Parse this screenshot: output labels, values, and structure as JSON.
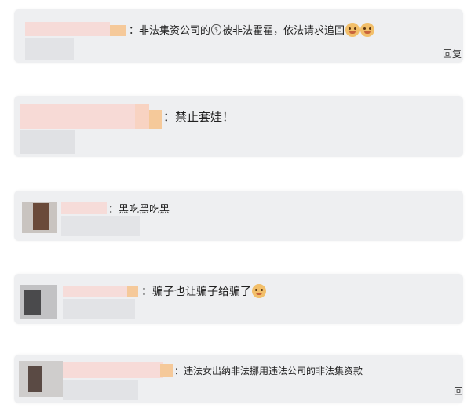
{
  "comments": [
    {
      "text_a": "：非法集资公司的",
      "text_b": "被非法霍霍，依法请求追回",
      "reply_label": "回复"
    },
    {
      "text": "：禁止套娃！"
    },
    {
      "text": "：黑吃黑吃黑"
    },
    {
      "text": "：骗子也让骗子给骗了"
    },
    {
      "text": "：违法女出纳非法挪用违法公司的非法集资款",
      "reply_label": "回"
    }
  ],
  "icons": {
    "money_bag": "money-bag-icon",
    "dog_face": "dog-face-emoji",
    "smirk_face": "smirk-face-emoji"
  },
  "colors": {
    "card_background": "#eeeff1",
    "text": "#222222",
    "blur_pink": "#f7d9d6",
    "blur_orange": "#f5c99a",
    "blur_gray": "#dfe0e3"
  }
}
